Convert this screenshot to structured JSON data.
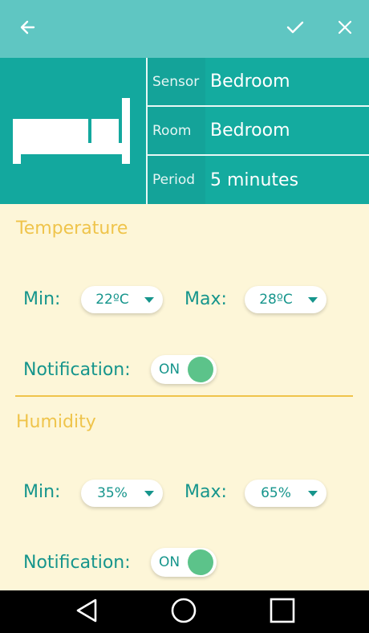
{
  "appbar": {
    "back_icon": "arrow-left-icon",
    "confirm_icon": "check-icon",
    "close_icon": "close-icon",
    "background": "#5fc6c2"
  },
  "header": {
    "icon": "bed-icon",
    "background": "#13a89e",
    "rows": [
      {
        "key": "Sensor",
        "value": "Bedroom"
      },
      {
        "key": "Room",
        "value": "Bedroom"
      },
      {
        "key": "Period",
        "value": "5 minutes"
      }
    ]
  },
  "temperature": {
    "title": "Temperature",
    "min_label": "Min:",
    "min_value": "22ºC",
    "max_label": "Max:",
    "max_value": "28ºC",
    "notification_label": "Notification:",
    "toggle_label": "ON",
    "toggle_on": true
  },
  "humidity": {
    "title": "Humidity",
    "min_label": "Min:",
    "min_value": "35%",
    "max_label": "Max:",
    "max_value": "65%",
    "notification_label": "Notification:",
    "toggle_label": "ON",
    "toggle_on": true
  },
  "colors": {
    "accent": "#16958c",
    "section_title": "#efc44b",
    "content_background": "#fdf6d8",
    "toggle_knob": "#5cc38a"
  },
  "navbar": {
    "back_icon": "nav-back-icon",
    "home_icon": "nav-home-icon",
    "recents_icon": "nav-recents-icon"
  }
}
